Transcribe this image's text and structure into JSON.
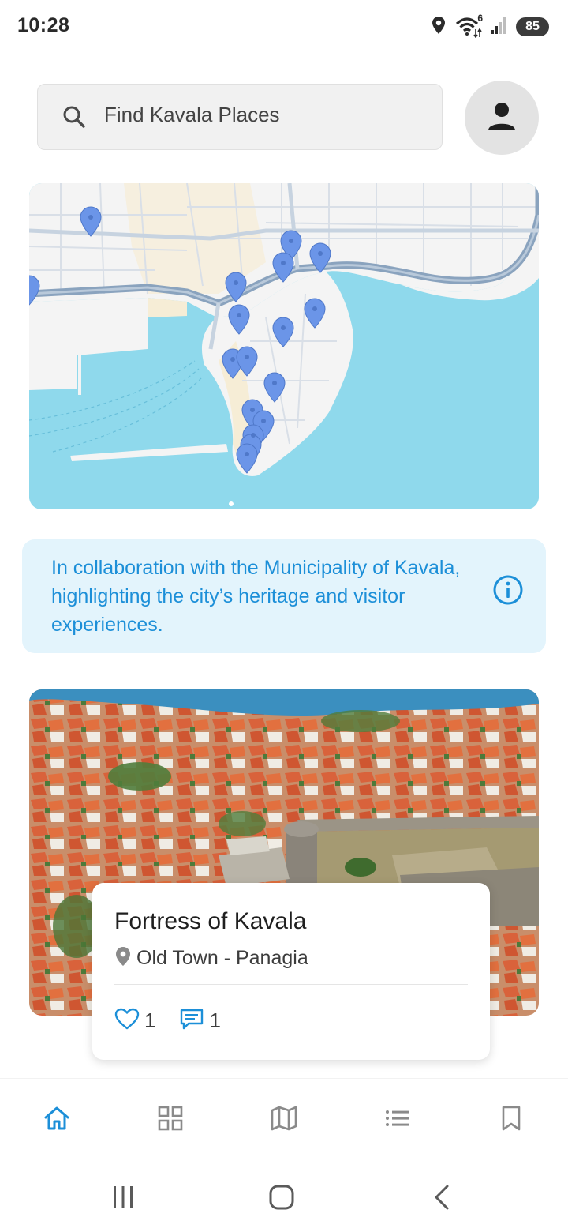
{
  "status_bar": {
    "time": "10:28",
    "battery": "85",
    "wifi_badge": "6",
    "icons": [
      "location-icon",
      "wifi-icon",
      "signal-icon",
      "battery-icon"
    ]
  },
  "search": {
    "placeholder": "Find Kavala Places",
    "icon": "search-icon"
  },
  "profile": {
    "icon": "person-icon"
  },
  "map": {
    "pin_count": 17,
    "colors": {
      "water": "#8fd9ec",
      "land": "#f4f4f4",
      "road": "#8aa3be",
      "pin": "#6b95e8"
    }
  },
  "info_banner": {
    "text": "In collaboration with the Municipality of Kavala, highlighting the city’s heritage and visitor experiences.",
    "icon": "info-icon",
    "colors": {
      "background": "#e3f4fc",
      "text": "#1c8fd8"
    }
  },
  "place_card": {
    "title": "Fortress of Kavala",
    "location": "Old Town - Panagia",
    "likes": "1",
    "comments": "1"
  },
  "bottom_nav": {
    "items": [
      {
        "name": "home",
        "icon": "home-icon",
        "active": true
      },
      {
        "name": "categories",
        "icon": "grid-icon",
        "active": false
      },
      {
        "name": "map",
        "icon": "map-icon",
        "active": false
      },
      {
        "name": "list",
        "icon": "list-icon",
        "active": false
      },
      {
        "name": "bookmarks",
        "icon": "bookmark-icon",
        "active": false
      }
    ],
    "active_color": "#1c8fd8",
    "inactive_color": "#8a8a8a"
  },
  "system_nav": {
    "icons": [
      "recents-icon",
      "home-button-icon",
      "back-icon"
    ]
  }
}
